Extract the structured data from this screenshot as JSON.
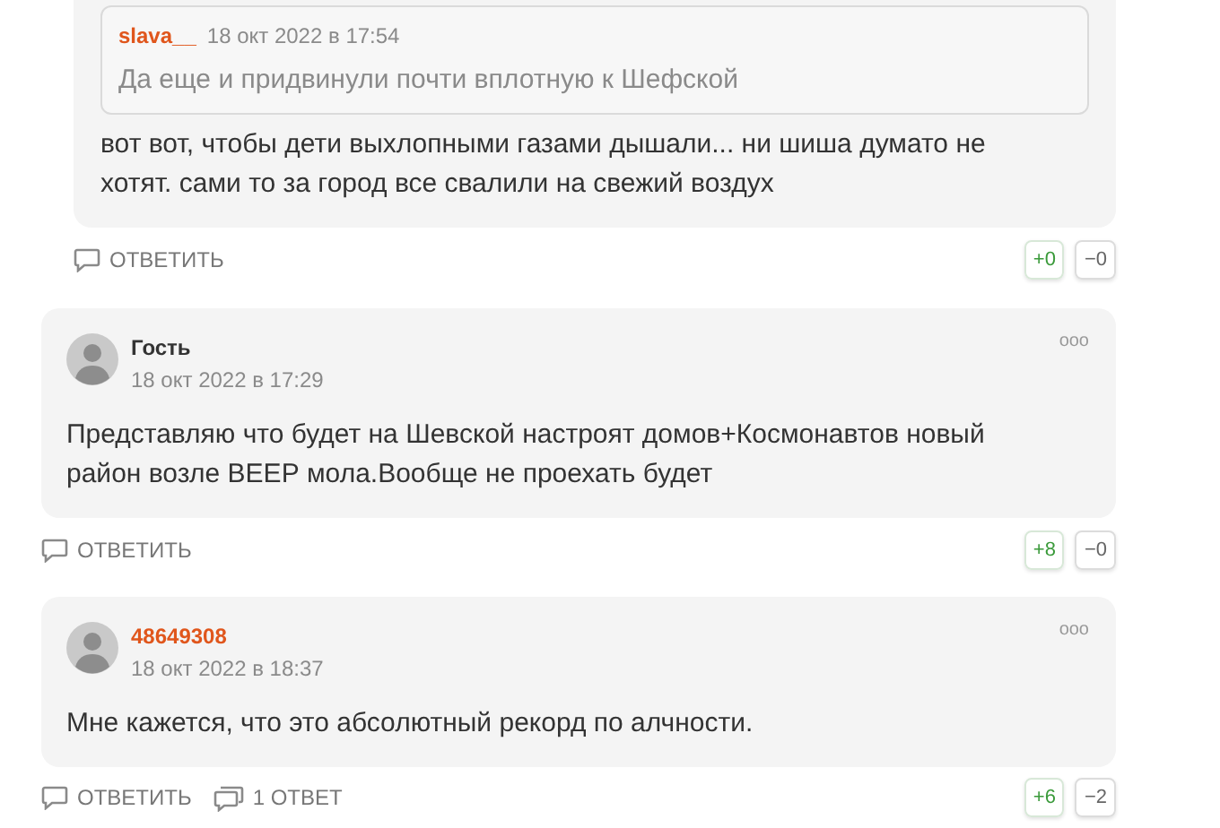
{
  "reply": {
    "quote": {
      "author": "slava__",
      "date": "18 окт 2022 в 17:54",
      "text": "Да еще и придвинули почти вплотную к Шефской"
    },
    "text": "вот вот, чтобы дети выхлопными газами дышали... ни шиша думато не хотят. сами то за город все свалили на свежий воздух",
    "actions": [
      {
        "kind": "reply",
        "label": "ОТВЕТИТЬ"
      }
    ],
    "up": "+0",
    "down": "−0"
  },
  "comments": [
    {
      "author": "Гость",
      "registered": false,
      "date": "18 окт 2022 в 17:29",
      "menu": "ooo",
      "text": "Представляю что будет на Шевской настроят домов+Космонавтов новый район возле ВЕЕР мола.Вообще не проехать будет",
      "actions": [
        {
          "kind": "reply",
          "label": "ОТВЕТИТЬ"
        }
      ],
      "up": "+8",
      "down": "−0"
    },
    {
      "author": "48649308",
      "registered": true,
      "date": "18 окт 2022 в 18:37",
      "menu": "ooo",
      "text": "Мне кажется, что это абсолютный рекорд по алчности.",
      "actions": [
        {
          "kind": "reply",
          "label": "ОТВЕТИТЬ"
        },
        {
          "kind": "replies",
          "label": "1 ОТВЕТ"
        }
      ],
      "up": "+6",
      "down": "−2"
    }
  ]
}
